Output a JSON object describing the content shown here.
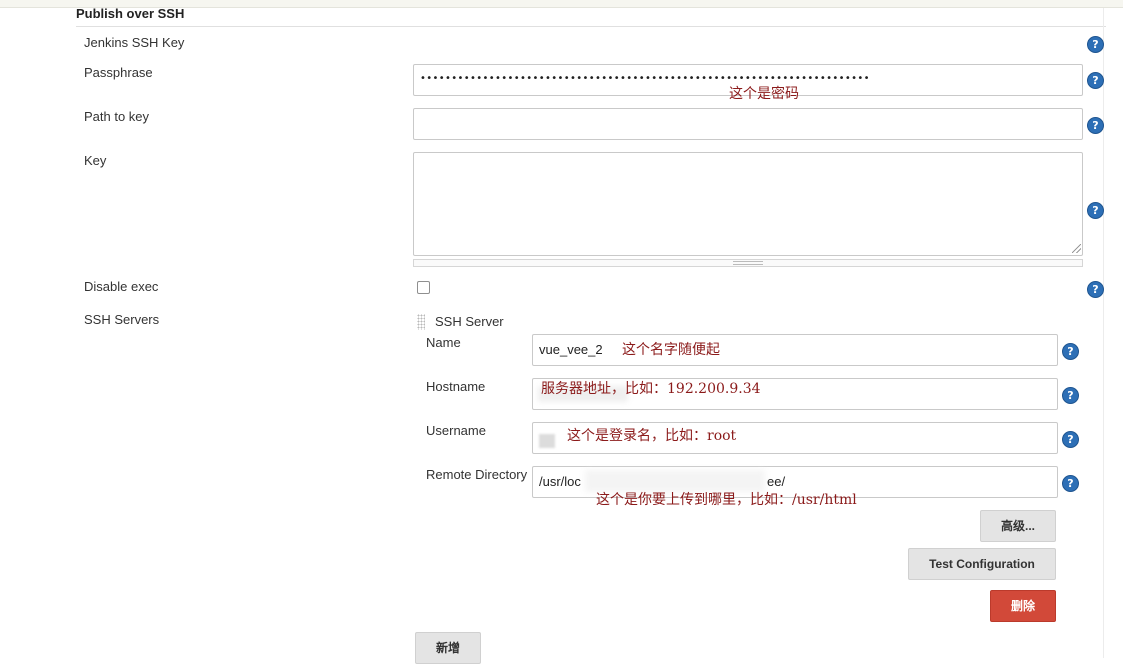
{
  "section": {
    "title": "Publish over SSH"
  },
  "fields": {
    "jenkins_ssh_key": {
      "label": "Jenkins SSH Key"
    },
    "passphrase": {
      "label": "Passphrase",
      "masked_value": "••••••••••••••••••••••••••••••••••••••••••••••••••••••••••••••••••••••••"
    },
    "path_to_key": {
      "label": "Path to key",
      "value": ""
    },
    "key": {
      "label": "Key",
      "value": ""
    },
    "disable_exec": {
      "label": "Disable exec",
      "checked": false
    },
    "ssh_servers": {
      "label": "SSH Servers"
    }
  },
  "ssh_server": {
    "title": "SSH Server",
    "name": {
      "label": "Name",
      "value": "vue_vee_2"
    },
    "hostname": {
      "label": "Hostname",
      "value": ""
    },
    "username": {
      "label": "Username",
      "value": ""
    },
    "remote_directory": {
      "label": "Remote Directory",
      "value_start": "/usr/loc",
      "value_end": "ee/"
    }
  },
  "buttons": {
    "advanced": "高级...",
    "test_configuration": "Test Configuration",
    "delete": "删除",
    "add": "新增"
  },
  "help_icon": "?",
  "annotations": {
    "passphrase": "这个是密码",
    "name": "这个名字随便起",
    "hostname": "服务器地址，比如：192.200.9.34",
    "username": "这个是登录名，比如：root",
    "remote_directory": "这个是你要上传到哪里，比如：/usr/html"
  },
  "colors": {
    "help_blue": "#2d6fb6",
    "annotation_red": "#8b1a1a",
    "danger_red": "#d24939"
  }
}
